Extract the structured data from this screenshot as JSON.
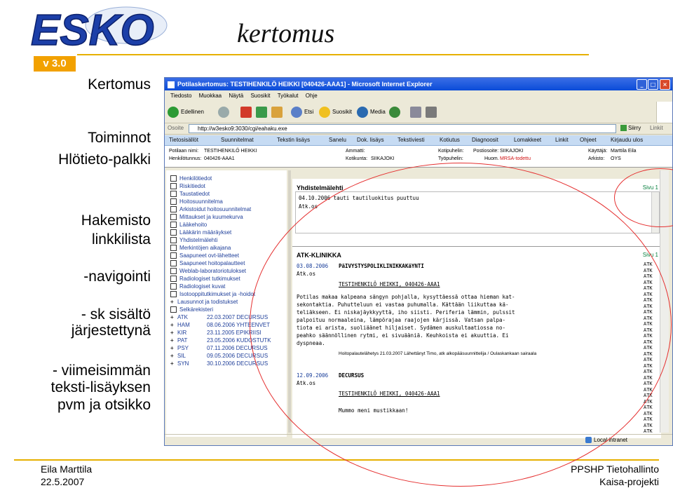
{
  "slide": {
    "logo_text": "ESKO",
    "version": "v 3.0",
    "title": "kertomus",
    "side_items": [
      "Kertomus",
      "Toiminnot",
      "Hlötieto-palkki",
      "Hakemisto",
      "linkkilista",
      "-navigointi",
      "- sk sisältö",
      "järjestettynä",
      "- viimeisimmän",
      "teksti-lisäyksen",
      "pvm ja otsikko"
    ],
    "footer_left": [
      "Eila Marttila",
      "22.5.2007"
    ],
    "footer_right": [
      "PPSHP Tietohallinto",
      "Kaisa-projekti"
    ],
    "accent_color": "#e6b000"
  },
  "browser": {
    "window_title": "Potilaskertomus: TESTIHENKILÖ HEIKKI [040426-AAA1] - Microsoft Internet Explorer",
    "menu": [
      "Tiedosto",
      "Muokkaa",
      "Näytä",
      "Suosikit",
      "Työkalut",
      "Ohje"
    ],
    "toolbar": {
      "back": "Edellinen",
      "search": "Etsi",
      "favorites": "Suosikit",
      "media": "Media"
    },
    "address_label": "Osoite",
    "address": "http://w3esko9:3030/cgi/eahaku.exe",
    "go": "Siirry",
    "links": "Linkit",
    "nav": [
      "Tietosisällöt",
      "Suunnitelmat",
      "Tekstin lisäys",
      "Sanelu",
      "Dok. lisäys",
      "Tekstiviesti",
      "Kotiutus",
      "Diagnoosit",
      "Lomakkeet",
      "Linkit",
      "Ohjeet",
      "Kirjaudu ulos"
    ],
    "patient": {
      "name_label": "Potilaan nimi:",
      "name": "TESTIHENKILÖ HEIKKI",
      "id_label": "Henkilötunnus:",
      "id": "040426-AAA1",
      "job_label": "Ammatti:",
      "municipality_label": "Kotikunta:",
      "municipality": "SIIKAJOKI",
      "phone_label": "Kotipuhelin:",
      "work_label": "Työpuhelin:",
      "postal_label": "Postiosoite:",
      "postal": "SIIKAJOKI",
      "note_label": "Huom.",
      "note": "MRSA-todettu",
      "user_label": "Käyttäjä:",
      "user": "Marttila Eila",
      "archive_label": "Arkisto:",
      "archive": "OYS"
    },
    "link_list": [
      {
        "label": "Henkilötiedot"
      },
      {
        "label": "Riskitiedot"
      },
      {
        "label": "Taustatiedot"
      },
      {
        "label": "Hoitosuunnitelma"
      },
      {
        "label": "Arkistoidut hoitosuunnitelmat"
      },
      {
        "label": "Mittaukset ja kuumekurva"
      },
      {
        "label": "Lääkehoito"
      },
      {
        "label": "Lääkärin määräykset"
      },
      {
        "label": "Yhdistelmälehti"
      },
      {
        "label": "Merkintöjen aikajana"
      },
      {
        "label": "Saapuneet ovt-lähetteet"
      },
      {
        "label": "Saapuneet hoitopalautteet"
      },
      {
        "label": "Weblab-laboratoriotulokset"
      },
      {
        "label": "Radiologiset tutkimukset"
      },
      {
        "label": "Radiologiset kuvat"
      },
      {
        "label": "Isotooppitutkimukset ja -hoidot"
      },
      {
        "label": "Lausunnot ja todistukset"
      },
      {
        "label": "Selkärekisteri"
      }
    ],
    "spec_list": [
      {
        "code": "ATK",
        "entry": "22.03.2007 DECURSUS"
      },
      {
        "code": "HAM",
        "entry": "08.06.2006 YHTEENVET"
      },
      {
        "code": "KIR",
        "entry": "23.11.2005 EPIKRIISI"
      },
      {
        "code": "PAT",
        "entry": "23.05.2006 KUDOSTUTK"
      },
      {
        "code": "PSY",
        "entry": "07.11.2006 DECURSUS"
      },
      {
        "code": "SIL",
        "entry": "09.05.2006 DECURSUS"
      },
      {
        "code": "SYN",
        "entry": "30.10.2006 DECURSUS"
      }
    ],
    "text": {
      "block1_head": "Yhdistelmälehti",
      "block1_page": "Sivu 1",
      "block1_lines": [
        "04.10.2006 tauti     tautiluokitus puuttuu",
        "Atk.os"
      ],
      "block2_head": "ATK-KLINIKKA",
      "block2_page": "Sivu 1",
      "entry1_date": "03.08.2006",
      "entry1_title": "PäIVYSTYSPOLIKLINIKKAKäYNTI",
      "entry1_unit": "Atk.os",
      "entry1_patient": "TESTIHENKILÖ HEIKKI, 040426-AAA1",
      "entry1_body": [
        "Potilas makaa kalpeana sängyn pohjalla, kysyttäessä ottaa hieman kat-",
        "sekontaktia. Puhutteluun ei vastaa puhumalla. Kättään liikuttaa kä-",
        "teliäkseen. Ei niskajäykkyyttä, iho siisti. Periferia lämmin, pulssit",
        "palpoituu normaaleina, lämpörajaa raajojen kärjissä. Vatsan palpa-",
        "tiota ei arista, suoliäänet hiljaiset. Sydämen auskultaatiossa no-",
        "peahko säännöllinen rytmi, ei sivuääniä. Keuhkoista ei akuuttia. Ei",
        "dyspneaa."
      ],
      "entry1_footer": "Hoitopalautelähetys 21.03.2007 Lähettänyt Timo, atk alkopääsuunnittelija / Oulaskankaan sairaala",
      "entry2_date": "12.09.2006",
      "entry2_title": "DECURSUS",
      "entry2_unit": "Atk.os",
      "entry2_patient": "TESTIHENKILÖ HEIKKI, 040426-AAA1",
      "entry2_body": "Mummo meni mustikkaan!",
      "atk_marker": "ATK"
    },
    "status": "Local intranet"
  }
}
